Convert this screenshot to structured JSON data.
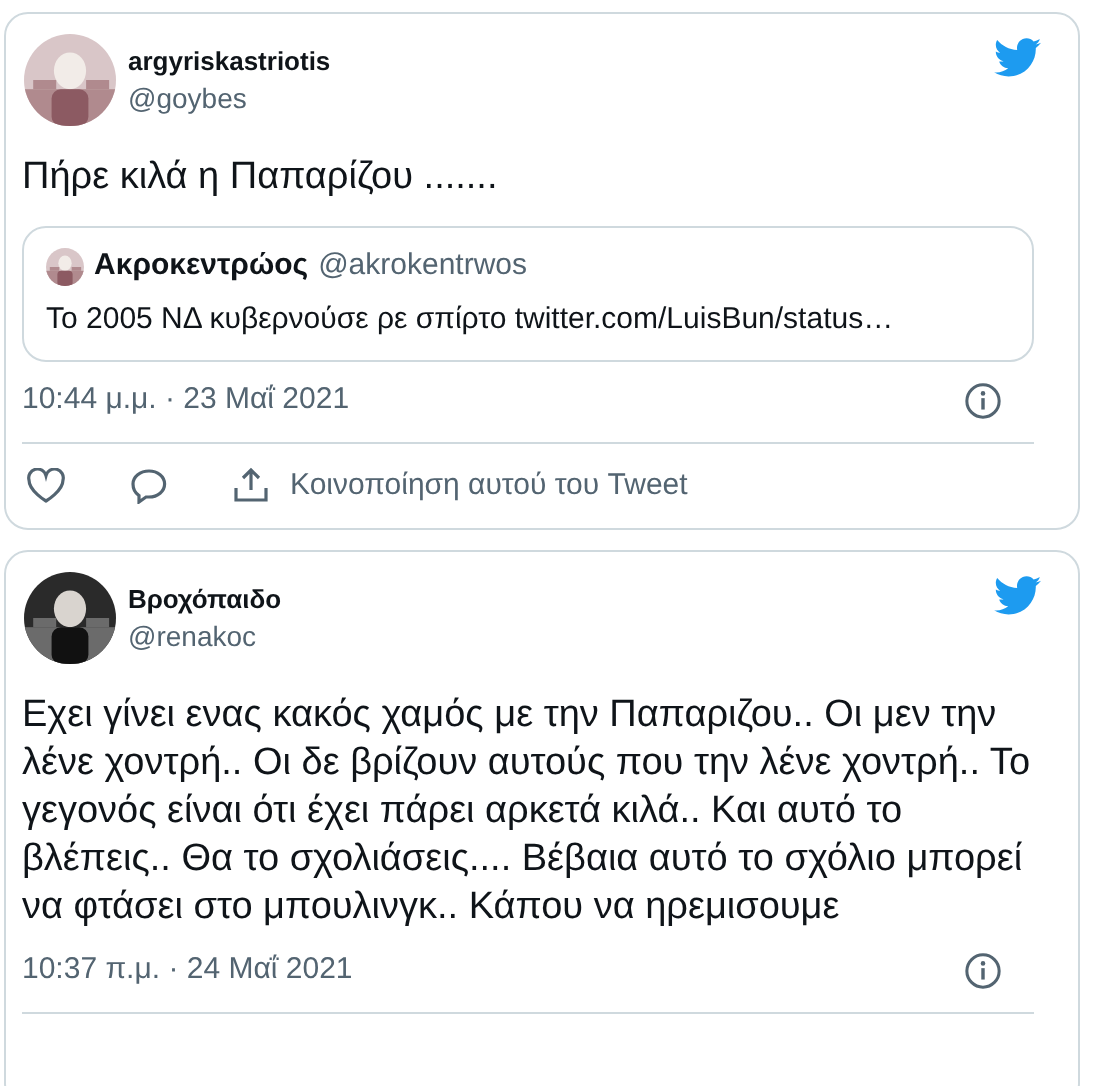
{
  "tweets": [
    {
      "name": "argyriskastriotis",
      "handle": "@goybes",
      "text": "Πήρε κιλά η Παπαρίζου .......",
      "quote": {
        "name": "Ακροκεντρώος",
        "handle": "@akrokentrwos",
        "text": "Το 2005 ΝΔ κυβερνούσε ρε σπίρτο twitter.com/LuisBun/status…"
      },
      "time": "10:44 μ.μ. · 23 Μαΐ 2021",
      "share": "Κοινοποίηση αυτού του Tweet"
    },
    {
      "name": "Βροχόπαιδο",
      "handle": "@renakoc",
      "text": "Εχει γίνει ενας κακός χαμός με την Παπαριζου.. Οι μεν την  λένε χοντρή.. Οι δε βρίζουν αυτούς που την λένε χοντρή.. Το γεγονός είναι ότι έχει πάρει αρκετά κιλά.. Και αυτό το βλέπεις.. Θα το σχολιάσεις.... Βέβαια αυτό το σχόλιο μπορεί να φτάσει στο μπουλινγκ.. Κάπου να ηρεμισουμε",
      "time": "10:37 π.μ. · 24 Μαΐ 2021"
    }
  ]
}
